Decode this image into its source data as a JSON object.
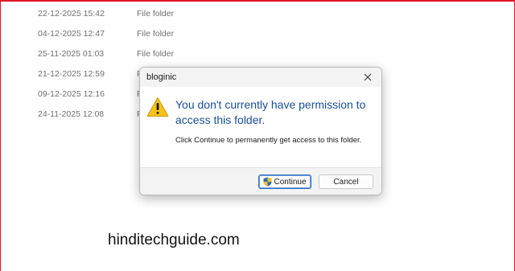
{
  "file_list": {
    "rows": [
      {
        "date": "22-12-2025 15:42",
        "type": "File folder"
      },
      {
        "date": "04-12-2025 12:47",
        "type": "File folder"
      },
      {
        "date": "25-11-2025 01:03",
        "type": "File folder"
      },
      {
        "date": "21-12-2025 12:59",
        "type": "F"
      },
      {
        "date": "09-12-2025 12:16",
        "type": "F"
      },
      {
        "date": "24-11-2025 12:08",
        "type": "F"
      }
    ]
  },
  "dialog": {
    "title": "bloginic",
    "close_icon": "close-icon",
    "warning_icon": "warning-triangle-icon",
    "headline": "You don't currently have permission to access this folder.",
    "message": "Click Continue to permanently get access to this folder.",
    "continue_label": "Continue",
    "continue_icon": "uac-shield-icon",
    "cancel_label": "Cancel"
  },
  "watermark": "hinditechguide.com",
  "colors": {
    "frame_border": "#e0162b",
    "headline": "#1a4f9c",
    "warning_fill": "#f7c21b",
    "default_button_border": "#2b6cc4"
  }
}
